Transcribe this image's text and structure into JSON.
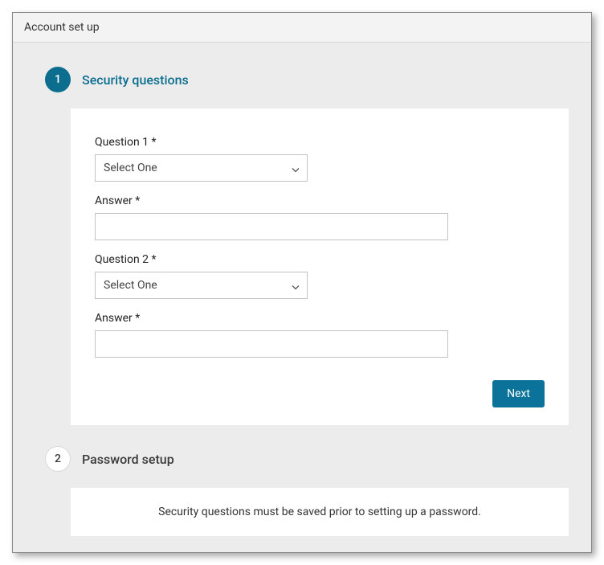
{
  "window": {
    "title": "Account set up"
  },
  "step1": {
    "number": "1",
    "title": "Security questions",
    "q1_label": "Question 1 *",
    "q1_selected": "Select One",
    "a1_label": "Answer *",
    "a1_value": "",
    "q2_label": "Question 2 *",
    "q2_selected": "Select One",
    "a2_label": "Answer *",
    "a2_value": "",
    "next_label": "Next"
  },
  "step2": {
    "number": "2",
    "title": "Password setup",
    "notice": "Security questions must be saved prior to setting up a password."
  }
}
